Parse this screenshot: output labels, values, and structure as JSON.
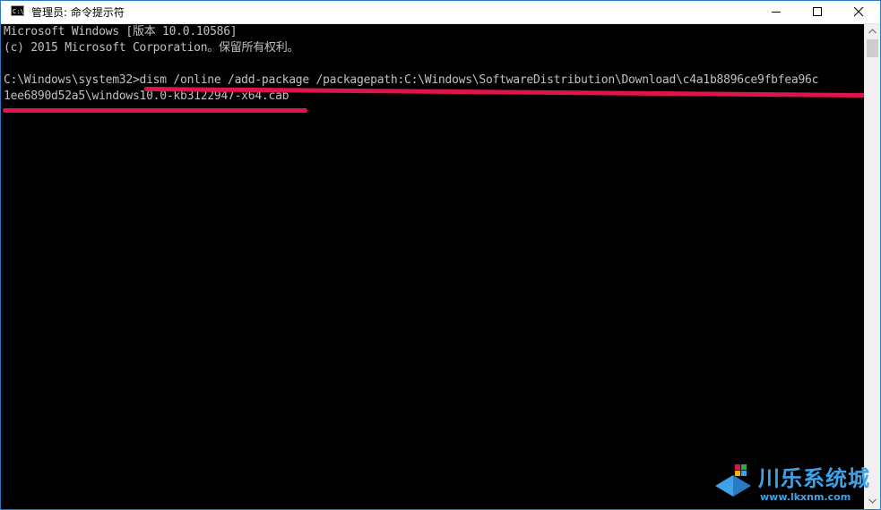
{
  "window": {
    "title": "管理员: 命令提示符",
    "icon": "cmd-icon",
    "controls": [
      "minimize-icon",
      "maximize-icon",
      "close-icon"
    ]
  },
  "console": {
    "lines": [
      "Microsoft Windows [版本 10.0.10586]",
      "(c) 2015 Microsoft Corporation。保留所有权利。",
      "C:\\Windows\\system32>dism /online /add-package /packagepath:C:\\Windows\\SoftwareDistribution\\Download\\c4a1b8896ce9fbfea96c",
      "1ee6890d52a5\\windows10.0-kb3122947-x64.cab"
    ]
  },
  "annotation": {
    "color": "#e0144c"
  },
  "watermark": {
    "name": "川乐系统城",
    "url": "www.lkxnm.com",
    "color": "#3fa2e6"
  },
  "colors": {
    "console_bg": "#000000",
    "console_text": "#c0c0c0",
    "window_border": "#2b79c2"
  }
}
